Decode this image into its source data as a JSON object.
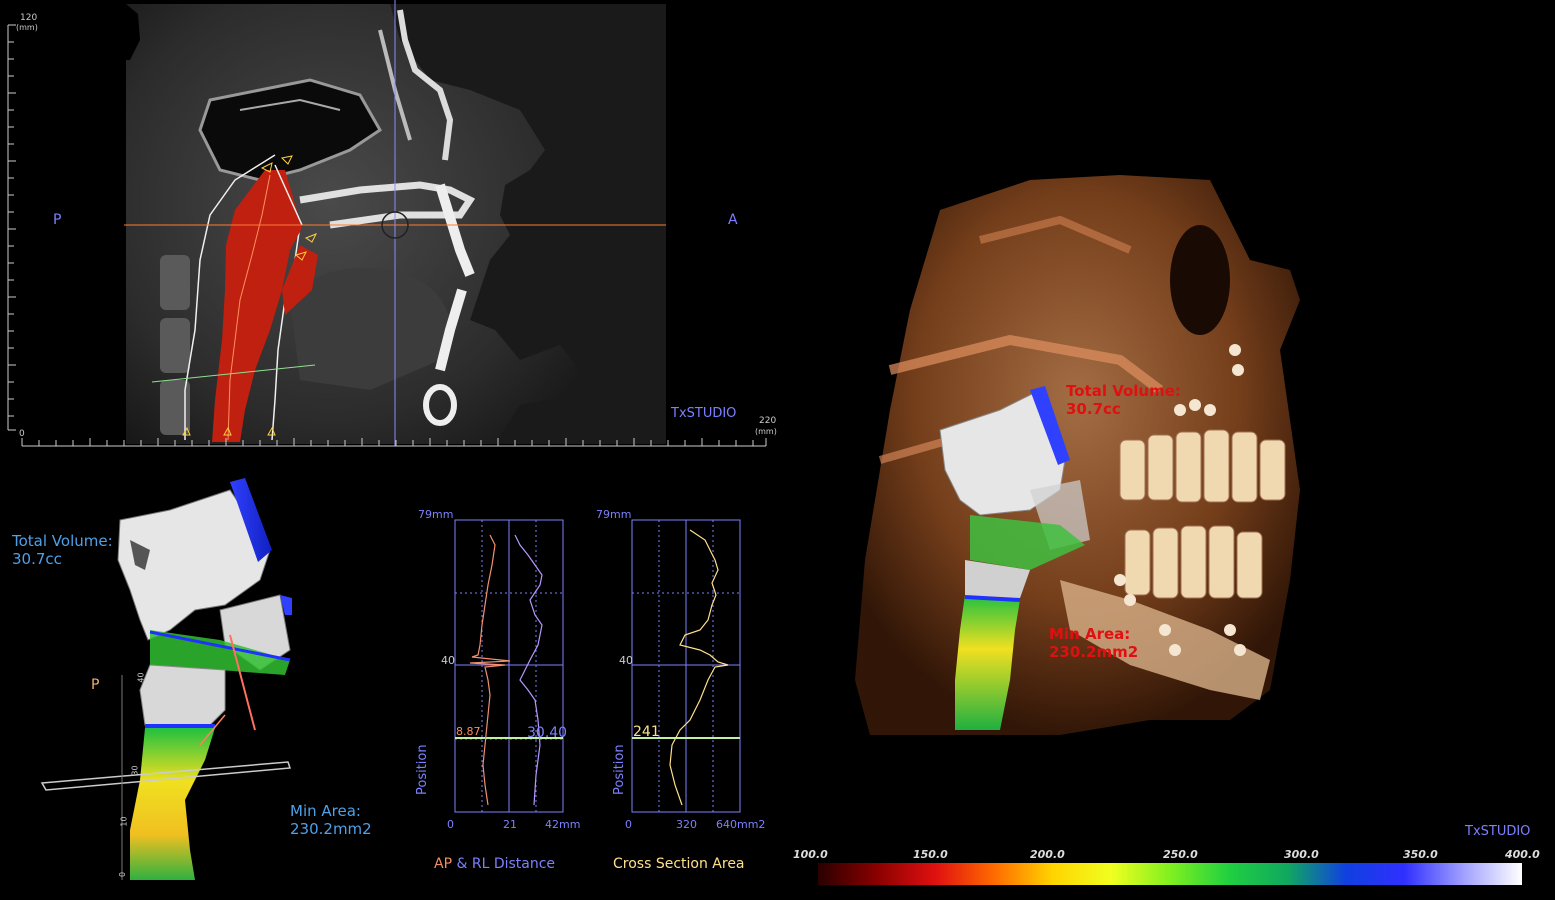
{
  "app_watermark": "TxSTUDIO",
  "sagittal_view": {
    "ruler_top_label": "120",
    "ruler_top_unit": "(mm)",
    "ruler_origin": "0",
    "ruler_right_label": "220",
    "ruler_right_unit": "(mm)",
    "posterior": "P",
    "anterior": "A",
    "watermark": "TxSTUDIO"
  },
  "airway_3d": {
    "total_volume_label": "Total Volume:",
    "total_volume_value": "30.7cc",
    "posterior": "P",
    "min_area_label": "Min Area:",
    "min_area_value": "230.2mm2",
    "scale_ticks": [
      "40",
      "30",
      "10",
      "0"
    ]
  },
  "graph_distance": {
    "y_max": "79mm",
    "y_mid": "40",
    "x_ticks": [
      "0",
      "21",
      "42mm"
    ],
    "ap_value": "8.87",
    "rl_value": "30.40",
    "y_axis_label": "Position",
    "title_ap": "AP",
    "title_rest": " & RL Distance"
  },
  "graph_area": {
    "y_max": "79mm",
    "y_mid": "40",
    "x_ticks": [
      "0",
      "320",
      "640mm2"
    ],
    "value": "241",
    "y_axis_label": "Position",
    "title": "Cross Section Area"
  },
  "render_3d": {
    "total_volume_label": "Total Volume:",
    "total_volume_value": "30.7cc",
    "min_area_label": "Min Area:",
    "min_area_value": "230.2mm2",
    "watermark": "TxSTUDIO"
  },
  "colorbar": {
    "labels": [
      "100.0",
      "150.0",
      "200.0",
      "250.0",
      "300.0",
      "350.0",
      "400.0"
    ],
    "colors": [
      "#2a0000",
      "#8a0000",
      "#e01010",
      "#ff6a00",
      "#ffd400",
      "#f0ff20",
      "#80f020",
      "#20d040",
      "#10a860",
      "#1040e0",
      "#3030ff",
      "#a0a0ff",
      "#ffffff"
    ]
  }
}
